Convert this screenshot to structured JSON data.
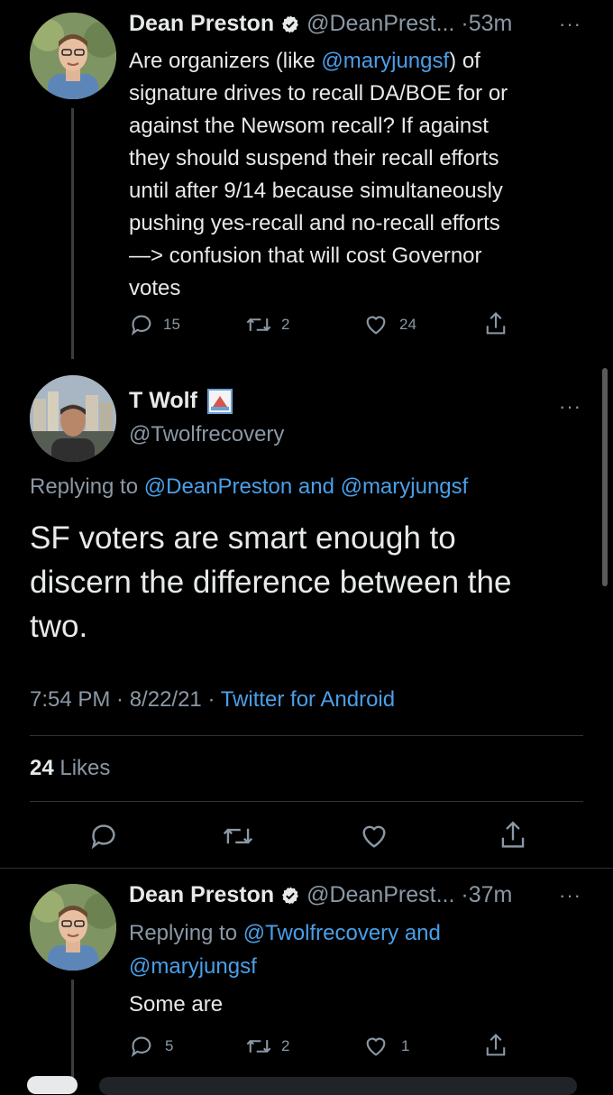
{
  "tweet1": {
    "name": "Dean Preston",
    "handle": "@DeanPrest...",
    "time": "·53m",
    "body_plain_1": "Are organizers (like ",
    "mention": "@maryjungsf",
    "body_plain_2": ") of",
    "lines": [
      "signature drives to recall DA/BOE for or",
      "against the Newsom recall? If against",
      "they should suspend their recall efforts",
      "until after 9/14 because  simultaneously",
      "pushing yes-recall and no-recall efforts",
      "—> confusion that will cost Governor",
      "votes"
    ],
    "replies": "15",
    "retweets": "2",
    "likes": "24"
  },
  "main_tweet": {
    "name": "T Wolf",
    "handle": "@Twolfrecovery",
    "replying_prefix": "Replying to ",
    "replying_mentions": "@DeanPreston and @maryjungsf",
    "lines": [
      "SF voters are smart enough to",
      "discern the difference between the",
      "two."
    ],
    "timestamp": "7:54 PM · 8/22/21 · ",
    "source": "Twitter for Android",
    "likes_count": "24",
    "likes_label": " Likes"
  },
  "tweet3": {
    "name": "Dean Preston",
    "handle": "@DeanPrest...",
    "time": "·37m",
    "replying_prefix": "Replying to ",
    "replying_line1": "@Twolfrecovery and",
    "replying_line2": "@maryjungsf",
    "body": "Some are",
    "replies": "5",
    "retweets": "2",
    "likes": "1"
  },
  "icons": {
    "verified": "verified-badge-icon",
    "more": "more-dots-icon",
    "reply": "reply-icon",
    "retweet": "retweet-icon",
    "like": "heart-icon",
    "share": "share-icon"
  },
  "colors": {
    "background": "#000000",
    "text": "#e7e9ea",
    "muted": "#8b98a5",
    "link": "#4a9fe8"
  }
}
